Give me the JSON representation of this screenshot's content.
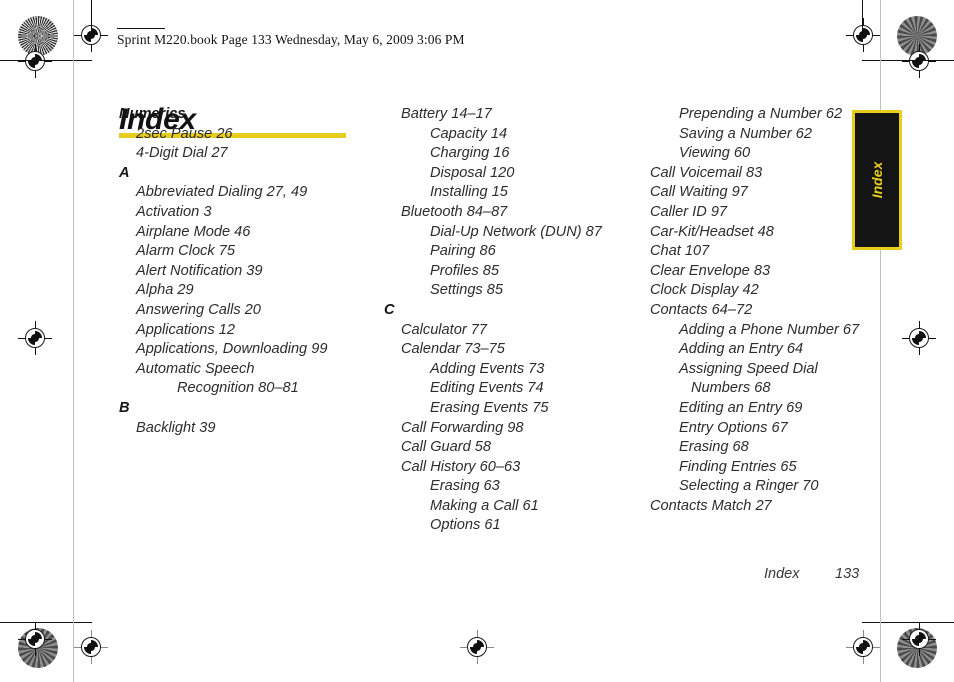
{
  "header": {
    "text": "Sprint M220.book  Page 133  Wednesday, May 6, 2009  3:06 PM"
  },
  "title": "Index",
  "colors": {
    "accent_yellow": "#E8CE1C",
    "tab_background": "#141414",
    "text": "#2d2d2d"
  },
  "side_tab": {
    "label": "Index"
  },
  "footer": {
    "label": "Index",
    "page_number": "133"
  },
  "columns": [
    {
      "id": "column-1",
      "entries": [
        {
          "level": "head",
          "text": "Numerics"
        },
        {
          "level": 1,
          "text": "2sec Pause 26"
        },
        {
          "level": 1,
          "text": "4-Digit Dial 27"
        },
        {
          "level": "head",
          "text": "A"
        },
        {
          "level": 1,
          "text": "Abbreviated Dialing 27, 49"
        },
        {
          "level": 1,
          "text": "Activation 3"
        },
        {
          "level": 1,
          "text": "Airplane Mode 46"
        },
        {
          "level": 1,
          "text": "Alarm Clock 75"
        },
        {
          "level": 1,
          "text": "Alert Notification 39"
        },
        {
          "level": 1,
          "text": "Alpha 29"
        },
        {
          "level": 1,
          "text": "Answering Calls 20"
        },
        {
          "level": 1,
          "text": "Applications 12"
        },
        {
          "level": 1,
          "text": "Applications, Downloading 99"
        },
        {
          "level": 1,
          "text": "Automatic Speech"
        },
        {
          "level": 3,
          "text": "Recognition 80–81"
        },
        {
          "level": "head",
          "text": "B"
        },
        {
          "level": 1,
          "text": "Backlight 39"
        }
      ]
    },
    {
      "id": "column-2",
      "entries": [
        {
          "level": 1,
          "text": "Battery 14–17"
        },
        {
          "level": 2,
          "text": "Capacity 14"
        },
        {
          "level": 2,
          "text": "Charging 16"
        },
        {
          "level": 2,
          "text": "Disposal 120"
        },
        {
          "level": 2,
          "text": "Installing 15"
        },
        {
          "level": 1,
          "text": "Bluetooth 84–87"
        },
        {
          "level": 2,
          "text": "Dial-Up Network (DUN) 87"
        },
        {
          "level": 2,
          "text": "Pairing 86"
        },
        {
          "level": 2,
          "text": "Profiles 85"
        },
        {
          "level": 2,
          "text": "Settings 85"
        },
        {
          "level": "head",
          "text": "C"
        },
        {
          "level": 1,
          "text": "Calculator 77"
        },
        {
          "level": 1,
          "text": "Calendar 73–75"
        },
        {
          "level": 2,
          "text": "Adding Events 73"
        },
        {
          "level": 2,
          "text": "Editing Events 74"
        },
        {
          "level": 2,
          "text": "Erasing Events 75"
        },
        {
          "level": 1,
          "text": "Call Forwarding 98"
        },
        {
          "level": 1,
          "text": "Call Guard 58"
        },
        {
          "level": 1,
          "text": "Call History 60–63"
        },
        {
          "level": 2,
          "text": "Erasing 63"
        },
        {
          "level": 2,
          "text": "Making a Call 61"
        },
        {
          "level": 2,
          "text": "Options 61"
        }
      ]
    },
    {
      "id": "column-3",
      "entries": [
        {
          "level": 2,
          "text": "Prepending a Number 62"
        },
        {
          "level": 2,
          "text": "Saving a Number 62"
        },
        {
          "level": 2,
          "text": "Viewing 60"
        },
        {
          "level": 1,
          "text": "Call Voicemail 83"
        },
        {
          "level": 1,
          "text": "Call Waiting 97"
        },
        {
          "level": 1,
          "text": "Caller ID 97"
        },
        {
          "level": 1,
          "text": "Car-Kit/Headset 48"
        },
        {
          "level": 1,
          "text": "Chat 107"
        },
        {
          "level": 1,
          "text": "Clear Envelope 83"
        },
        {
          "level": 1,
          "text": "Clock Display 42"
        },
        {
          "level": 1,
          "text": "Contacts 64–72"
        },
        {
          "level": 2,
          "text": "Adding a Phone Number 67"
        },
        {
          "level": 2,
          "text": "Adding an Entry 64"
        },
        {
          "level": 2,
          "text": "Assigning Speed Dial"
        },
        {
          "level": 3,
          "text": "Numbers 68"
        },
        {
          "level": 2,
          "text": "Editing an Entry 69"
        },
        {
          "level": 2,
          "text": "Entry Options 67"
        },
        {
          "level": 2,
          "text": "Erasing 68"
        },
        {
          "level": 2,
          "text": "Finding Entries 65"
        },
        {
          "level": 2,
          "text": "Selecting a Ringer 70"
        },
        {
          "level": 1,
          "text": "Contacts Match 27"
        }
      ]
    }
  ]
}
